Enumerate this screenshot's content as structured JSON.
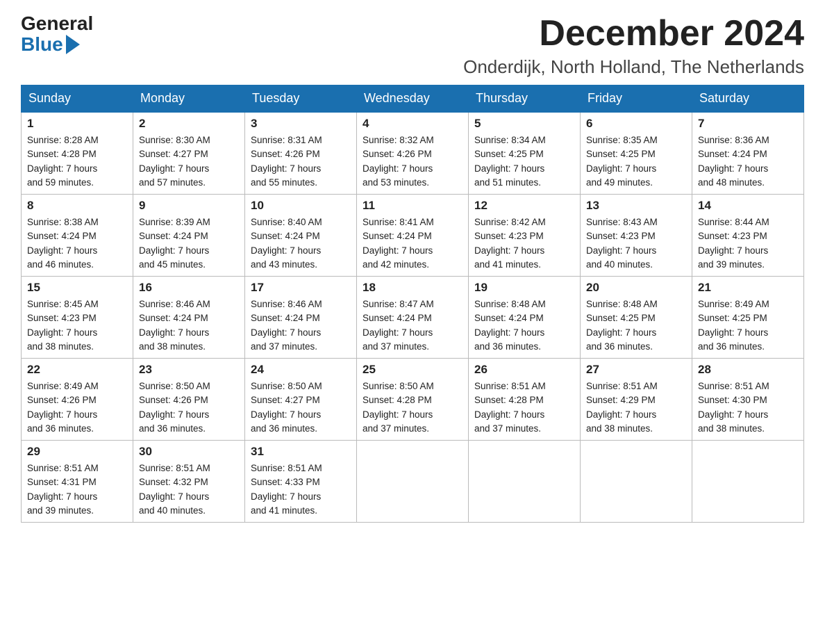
{
  "logo": {
    "general": "General",
    "blue": "Blue"
  },
  "header": {
    "month": "December 2024",
    "location": "Onderdijk, North Holland, The Netherlands"
  },
  "days_of_week": [
    "Sunday",
    "Monday",
    "Tuesday",
    "Wednesday",
    "Thursday",
    "Friday",
    "Saturday"
  ],
  "weeks": [
    [
      {
        "day": "1",
        "sunrise": "8:28 AM",
        "sunset": "4:28 PM",
        "daylight": "7 hours and 59 minutes."
      },
      {
        "day": "2",
        "sunrise": "8:30 AM",
        "sunset": "4:27 PM",
        "daylight": "7 hours and 57 minutes."
      },
      {
        "day": "3",
        "sunrise": "8:31 AM",
        "sunset": "4:26 PM",
        "daylight": "7 hours and 55 minutes."
      },
      {
        "day": "4",
        "sunrise": "8:32 AM",
        "sunset": "4:26 PM",
        "daylight": "7 hours and 53 minutes."
      },
      {
        "day": "5",
        "sunrise": "8:34 AM",
        "sunset": "4:25 PM",
        "daylight": "7 hours and 51 minutes."
      },
      {
        "day": "6",
        "sunrise": "8:35 AM",
        "sunset": "4:25 PM",
        "daylight": "7 hours and 49 minutes."
      },
      {
        "day": "7",
        "sunrise": "8:36 AM",
        "sunset": "4:24 PM",
        "daylight": "7 hours and 48 minutes."
      }
    ],
    [
      {
        "day": "8",
        "sunrise": "8:38 AM",
        "sunset": "4:24 PM",
        "daylight": "7 hours and 46 minutes."
      },
      {
        "day": "9",
        "sunrise": "8:39 AM",
        "sunset": "4:24 PM",
        "daylight": "7 hours and 45 minutes."
      },
      {
        "day": "10",
        "sunrise": "8:40 AM",
        "sunset": "4:24 PM",
        "daylight": "7 hours and 43 minutes."
      },
      {
        "day": "11",
        "sunrise": "8:41 AM",
        "sunset": "4:24 PM",
        "daylight": "7 hours and 42 minutes."
      },
      {
        "day": "12",
        "sunrise": "8:42 AM",
        "sunset": "4:23 PM",
        "daylight": "7 hours and 41 minutes."
      },
      {
        "day": "13",
        "sunrise": "8:43 AM",
        "sunset": "4:23 PM",
        "daylight": "7 hours and 40 minutes."
      },
      {
        "day": "14",
        "sunrise": "8:44 AM",
        "sunset": "4:23 PM",
        "daylight": "7 hours and 39 minutes."
      }
    ],
    [
      {
        "day": "15",
        "sunrise": "8:45 AM",
        "sunset": "4:23 PM",
        "daylight": "7 hours and 38 minutes."
      },
      {
        "day": "16",
        "sunrise": "8:46 AM",
        "sunset": "4:24 PM",
        "daylight": "7 hours and 38 minutes."
      },
      {
        "day": "17",
        "sunrise": "8:46 AM",
        "sunset": "4:24 PM",
        "daylight": "7 hours and 37 minutes."
      },
      {
        "day": "18",
        "sunrise": "8:47 AM",
        "sunset": "4:24 PM",
        "daylight": "7 hours and 37 minutes."
      },
      {
        "day": "19",
        "sunrise": "8:48 AM",
        "sunset": "4:24 PM",
        "daylight": "7 hours and 36 minutes."
      },
      {
        "day": "20",
        "sunrise": "8:48 AM",
        "sunset": "4:25 PM",
        "daylight": "7 hours and 36 minutes."
      },
      {
        "day": "21",
        "sunrise": "8:49 AM",
        "sunset": "4:25 PM",
        "daylight": "7 hours and 36 minutes."
      }
    ],
    [
      {
        "day": "22",
        "sunrise": "8:49 AM",
        "sunset": "4:26 PM",
        "daylight": "7 hours and 36 minutes."
      },
      {
        "day": "23",
        "sunrise": "8:50 AM",
        "sunset": "4:26 PM",
        "daylight": "7 hours and 36 minutes."
      },
      {
        "day": "24",
        "sunrise": "8:50 AM",
        "sunset": "4:27 PM",
        "daylight": "7 hours and 36 minutes."
      },
      {
        "day": "25",
        "sunrise": "8:50 AM",
        "sunset": "4:28 PM",
        "daylight": "7 hours and 37 minutes."
      },
      {
        "day": "26",
        "sunrise": "8:51 AM",
        "sunset": "4:28 PM",
        "daylight": "7 hours and 37 minutes."
      },
      {
        "day": "27",
        "sunrise": "8:51 AM",
        "sunset": "4:29 PM",
        "daylight": "7 hours and 38 minutes."
      },
      {
        "day": "28",
        "sunrise": "8:51 AM",
        "sunset": "4:30 PM",
        "daylight": "7 hours and 38 minutes."
      }
    ],
    [
      {
        "day": "29",
        "sunrise": "8:51 AM",
        "sunset": "4:31 PM",
        "daylight": "7 hours and 39 minutes."
      },
      {
        "day": "30",
        "sunrise": "8:51 AM",
        "sunset": "4:32 PM",
        "daylight": "7 hours and 40 minutes."
      },
      {
        "day": "31",
        "sunrise": "8:51 AM",
        "sunset": "4:33 PM",
        "daylight": "7 hours and 41 minutes."
      },
      null,
      null,
      null,
      null
    ]
  ],
  "labels": {
    "sunrise": "Sunrise:",
    "sunset": "Sunset:",
    "daylight": "Daylight:"
  }
}
